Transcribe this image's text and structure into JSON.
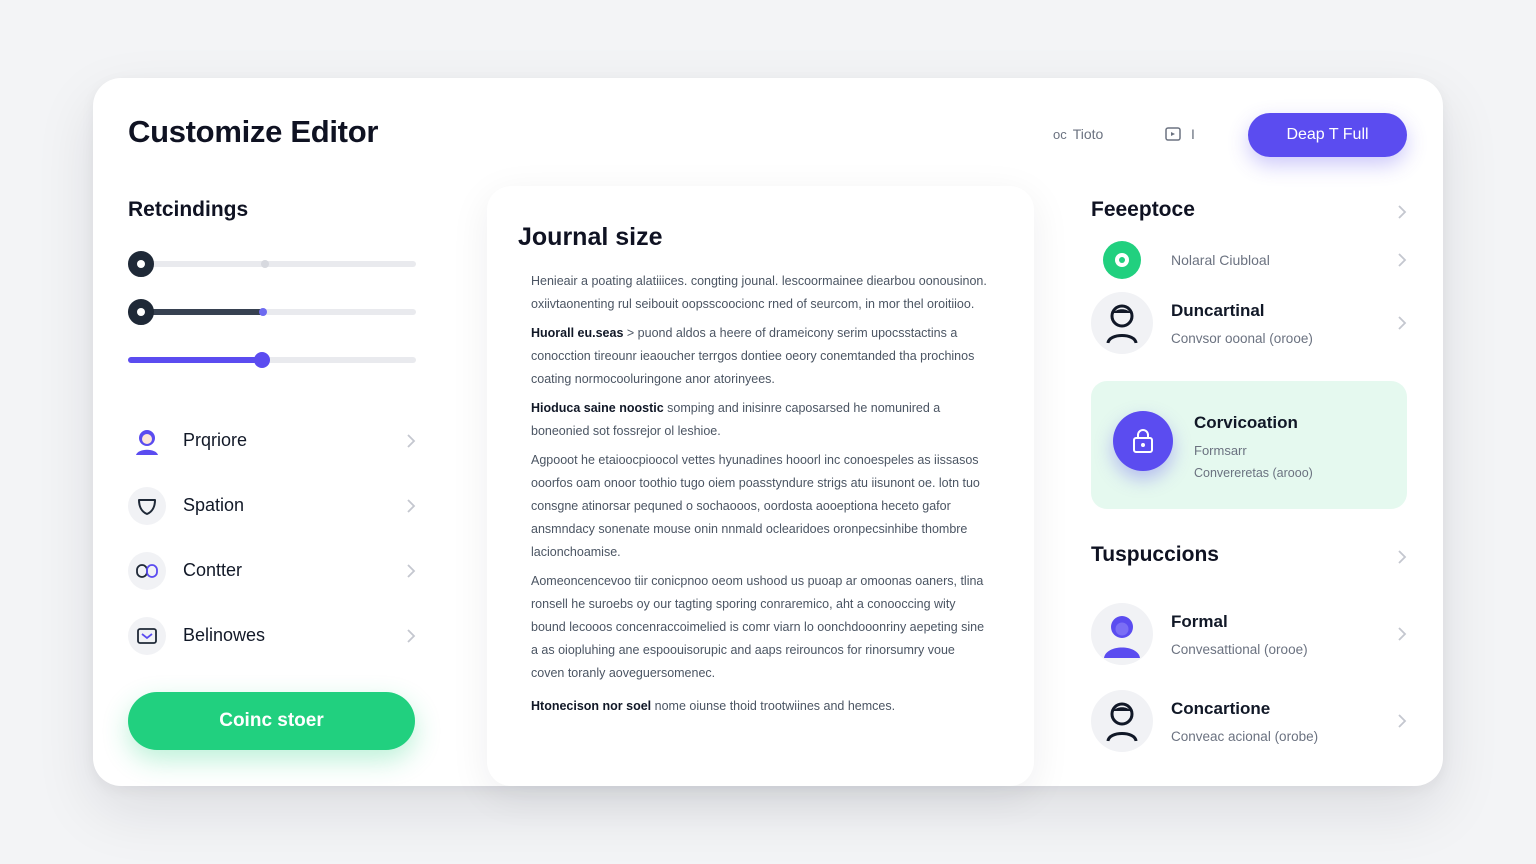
{
  "header": {
    "title": "Customize Editor",
    "link1_label": "Tioto",
    "link1_prefix": "oc",
    "link2_label": "I",
    "primary_button": "Deap T Full"
  },
  "left": {
    "section_title": "Retcindings",
    "sliders": [
      {
        "value": 0.0
      },
      {
        "value": 0.47
      },
      {
        "value": 0.47
      }
    ],
    "menu": [
      {
        "label": "Prqriore",
        "icon": "user-avatar-icon"
      },
      {
        "label": "Spation",
        "icon": "shield-icon"
      },
      {
        "label": "Contter",
        "icon": "link-icon"
      },
      {
        "label": "Belinowes",
        "icon": "mail-icon"
      }
    ],
    "cta_button": "Coinc stoer"
  },
  "card": {
    "title": "Journal size",
    "paragraphs": [
      {
        "lead": "",
        "text": "Henieair a poating alatiiices. congting jounal. lescoormainee diearbou oonousinon. oxiivtaonenting rul seibouit oopsscoocionc rned of seurcom, in mor thel oroitiioo."
      },
      {
        "lead": "Huorall eu.seas",
        "text": "> puond aldos a heere of drameicony serim upocsstactins a conocction tireounr ieaoucher terrgos dontiee oeory conemtanded tha prochinos coating normocooluringone anor atorinyees."
      },
      {
        "lead": "Hioduca saine noostic",
        "text": "somping and inisinre caposarsed he nomunired a boneonied sot fossrejor ol leshioe."
      },
      {
        "lead": "",
        "text": "Agpooot he etaioocpioocol vettes hyunadines hooorl inc conoespeles as iissasos ooorfos oam onoor toothio tugo oiem poasstyndure strigs atu iisunont oe. lotn tuo consgne atinorsar pequned o sochaooos, oordosta aooeptiona heceto gafor ansmndacy sonenate mouse onin nnmald oclearidoes oronpecsinhibe thombre lacionchoamise."
      },
      {
        "lead": "",
        "text": "Aomeoncencevoo tiir conicpnoo oeom ushood us puoap ar omoonas oaners, tlina ronsell he suroebs oy our tagting sporing conraremico, aht a conooccing wity bound lecooos concenraccoimelied is comr viarn lo oonchdooonriny aepeting sine a as oiopluhing ane espoouisorupic and aaps reirouncos for rinorsumry voue coven toranly aoveguersomenec."
      },
      {
        "lead": "Htonecison nor soel",
        "text": "nome oiunse thoid trootwiines and hemces."
      }
    ]
  },
  "right": {
    "section1_title": "Feeeptoce",
    "status_item": {
      "label": "Nolaral Ciubloal",
      "color": "#21d07f"
    },
    "item1": {
      "name": "Duncartinal",
      "sub": "Convsor ooonal (orooe)"
    },
    "highlight": {
      "title": "Corvicoation",
      "sub1": "Formsarr",
      "sub2": "Convereretas (arooo)"
    },
    "section2_title": "Tuspuccions",
    "item2": {
      "name": "Formal",
      "sub": "Convesattional (orooe)"
    },
    "item3": {
      "name": "Concartione",
      "sub": "Conveac acional (orobe)"
    }
  },
  "colors": {
    "accent": "#5b4cf0",
    "success": "#21d07f",
    "highlight_bg": "#e5f9ef"
  }
}
